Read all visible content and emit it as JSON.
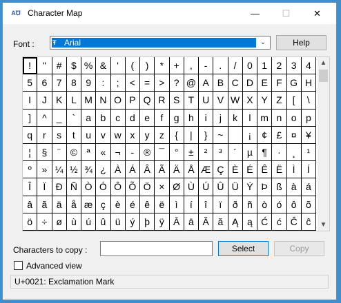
{
  "window": {
    "title": "Character Map"
  },
  "titlebar": {
    "minimize": "—",
    "maximize": "☐",
    "close": "✕",
    "icon": "charmap-app-icon"
  },
  "font": {
    "label": "Font :",
    "selected": "Arial",
    "icon": "truetype-icon"
  },
  "help": {
    "label": "Help"
  },
  "grid": {
    "rows": [
      [
        "!",
        "\"",
        "#",
        "$",
        "%",
        "&",
        "'",
        "(",
        ")",
        "*",
        "+",
        ",",
        "-",
        ".",
        "/",
        "0",
        "1",
        "2",
        "3",
        "4"
      ],
      [
        "5",
        "6",
        "7",
        "8",
        "9",
        ":",
        ";",
        "<",
        "=",
        ">",
        "?",
        "@",
        "A",
        "B",
        "C",
        "D",
        "E",
        "F",
        "G",
        "H"
      ],
      [
        "I",
        "J",
        "K",
        "L",
        "M",
        "N",
        "O",
        "P",
        "Q",
        "R",
        "S",
        "T",
        "U",
        "V",
        "W",
        "X",
        "Y",
        "Z",
        "[",
        "\\"
      ],
      [
        "]",
        "^",
        "_",
        "`",
        "a",
        "b",
        "c",
        "d",
        "e",
        "f",
        "g",
        "h",
        "i",
        "j",
        "k",
        "l",
        "m",
        "n",
        "o",
        "p"
      ],
      [
        "q",
        "r",
        "s",
        "t",
        "u",
        "v",
        "w",
        "x",
        "y",
        "z",
        "{",
        "|",
        "}",
        "~",
        " ",
        "¡",
        "¢",
        "£",
        "¤",
        "¥"
      ],
      [
        "¦",
        "§",
        "¨",
        "©",
        "ª",
        "«",
        "¬",
        "-",
        "®",
        "¯",
        "°",
        "±",
        "²",
        "³",
        "´",
        "µ",
        "¶",
        "·",
        "¸",
        "¹"
      ],
      [
        "º",
        "»",
        "¼",
        "½",
        "¾",
        "¿",
        "À",
        "Á",
        "Â",
        "Ã",
        "Ä",
        "Å",
        "Æ",
        "Ç",
        "È",
        "É",
        "Ê",
        "Ë",
        "Ì",
        "Í"
      ],
      [
        "Î",
        "Ï",
        "Ð",
        "Ñ",
        "Ò",
        "Ó",
        "Ô",
        "Õ",
        "Ö",
        "×",
        "Ø",
        "Ù",
        "Ú",
        "Û",
        "Ü",
        "Ý",
        "Þ",
        "ß",
        "à",
        "á"
      ],
      [
        "â",
        "ã",
        "ä",
        "å",
        "æ",
        "ç",
        "è",
        "é",
        "ê",
        "ë",
        "ì",
        "í",
        "î",
        "ï",
        "ð",
        "ñ",
        "ò",
        "ó",
        "ô",
        "õ"
      ],
      [
        "ö",
        "÷",
        "ø",
        "ù",
        "ú",
        "û",
        "ü",
        "ý",
        "þ",
        "ÿ",
        "Ā",
        "ā",
        "Ă",
        "ă",
        "Ą",
        "ą",
        "Ć",
        "ć",
        "Ĉ",
        "ĉ"
      ]
    ],
    "selected": "!"
  },
  "scrollbar": {
    "up": "▲",
    "down": "▼"
  },
  "copy": {
    "label": "Characters to copy :",
    "value": "",
    "select_label": "Select",
    "copy_label": "Copy"
  },
  "advanced": {
    "label": "Advanced view",
    "checked": false
  },
  "status": {
    "text": "U+0021: Exclamation Mark"
  },
  "colors": {
    "selection": "#0078d7",
    "background": "#f0f0f0",
    "desktop": "#3d8fd0"
  }
}
